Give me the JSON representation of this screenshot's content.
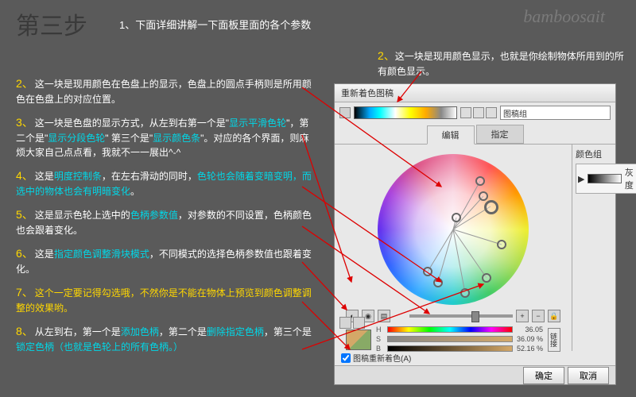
{
  "header": {
    "step": "第三步",
    "intro": "1、下面详细讲解一下面板里面的各个参数",
    "watermark": "bamboosait"
  },
  "topNote": {
    "num": "2、",
    "text": "这一块是现用颜色显示，也就是你绘制物体所用到的所有颜色显示。"
  },
  "notes": [
    {
      "num": "2、",
      "parts": [
        {
          "t": "这一块是现用颜色在色盘上的显示，色盘上的圆点手柄则是所用颜色在色盘上的对应位置。"
        }
      ]
    },
    {
      "num": "3、",
      "parts": [
        {
          "t": "这一块是色盘的显示方式，从左到右第一个是\""
        },
        {
          "t": "显示平滑色轮",
          "c": "hl-cyan"
        },
        {
          "t": "\"，第二个是\""
        },
        {
          "t": "显示分段色轮",
          "c": "hl-cyan"
        },
        {
          "t": "\" 第三个是\""
        },
        {
          "t": "显示颜色条",
          "c": "hl-cyan"
        },
        {
          "t": "\"。对应的各个界面，则麻烦大家自己点点看，我就不一一展出^-^"
        }
      ]
    },
    {
      "num": "4、",
      "parts": [
        {
          "t": "这是"
        },
        {
          "t": "明度控制条",
          "c": "hl-cyan"
        },
        {
          "t": "，在左右滑动的同时，"
        },
        {
          "t": "色轮也会随着变暗变明，而选中的物体也会有明暗变化",
          "c": "hl-cyan"
        },
        {
          "t": "。"
        }
      ]
    },
    {
      "num": "5、",
      "parts": [
        {
          "t": "这是显示色轮上选中的"
        },
        {
          "t": "色柄参数值",
          "c": "hl-cyan"
        },
        {
          "t": "，对参数的不同设置，色柄颜色也会跟着变化。"
        }
      ]
    },
    {
      "num": "6、",
      "parts": [
        {
          "t": "这是"
        },
        {
          "t": "指定颜色调整滑块模式",
          "c": "hl-cyan"
        },
        {
          "t": "，不同模式的选择色柄参数值也跟着变化。"
        }
      ]
    },
    {
      "num": "7、",
      "parts": [
        {
          "t": "这个一定要记得勾选哦，不然你是不能在物体上预览到颜色调整调整的效果哟。",
          "c": "hl-yellow"
        }
      ]
    },
    {
      "num": "8、",
      "parts": [
        {
          "t": "从左到右，第一个是"
        },
        {
          "t": "添加色柄",
          "c": "hl-cyan"
        },
        {
          "t": "，第二个是"
        },
        {
          "t": "删除指定色柄",
          "c": "hl-cyan"
        },
        {
          "t": "，第三个是"
        },
        {
          "t": "锁定色柄（也就是色轮上的所有色柄。）",
          "c": "hl-cyan"
        }
      ]
    }
  ],
  "panel": {
    "title": "重新着色图稿",
    "select": "图稿组",
    "tabs": {
      "edit": "编辑",
      "assign": "指定"
    },
    "rightCol": {
      "title": "颜色组",
      "gray": "灰度"
    },
    "hsb": {
      "h": "36.05",
      "s": "36.09 %",
      "b": "52.16 %"
    },
    "link": "链接",
    "checkbox": "图稿重新着色(A)",
    "ok": "确定",
    "cancel": "取消"
  }
}
